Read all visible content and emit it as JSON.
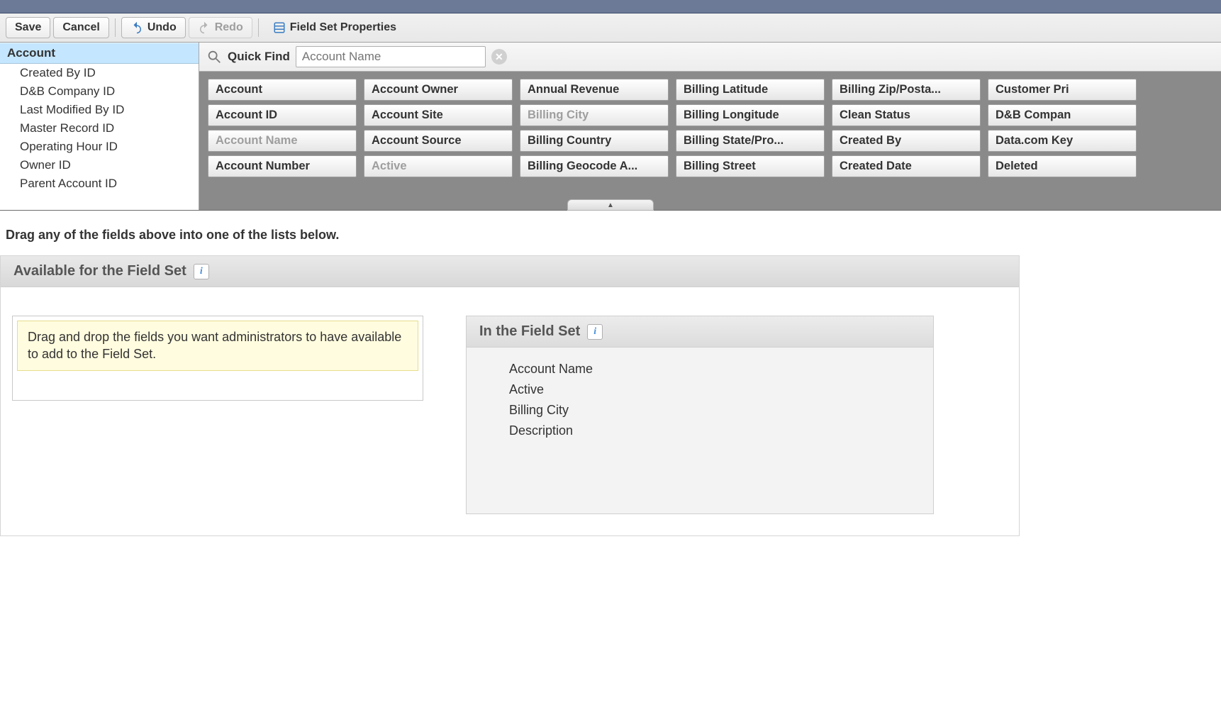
{
  "toolbar": {
    "save": "Save",
    "cancel": "Cancel",
    "undo": "Undo",
    "redo": "Redo",
    "props": "Field Set Properties"
  },
  "object_tree": {
    "title": "Account",
    "items": [
      "Created By ID",
      "D&B Company ID",
      "Last Modified By ID",
      "Master Record ID",
      "Operating Hour ID",
      "Owner ID",
      "Parent Account ID"
    ]
  },
  "quick_find": {
    "label": "Quick Find",
    "placeholder": "Account Name"
  },
  "field_grid": [
    [
      {
        "label": "Account",
        "disabled": false
      },
      {
        "label": "Account ID",
        "disabled": false
      },
      {
        "label": "Account Name",
        "disabled": true
      },
      {
        "label": "Account Number",
        "disabled": false
      }
    ],
    [
      {
        "label": "Account Owner",
        "disabled": false
      },
      {
        "label": "Account Site",
        "disabled": false
      },
      {
        "label": "Account Source",
        "disabled": false
      },
      {
        "label": "Active",
        "disabled": true
      }
    ],
    [
      {
        "label": "Annual Revenue",
        "disabled": false
      },
      {
        "label": "Billing City",
        "disabled": true
      },
      {
        "label": "Billing Country",
        "disabled": false
      },
      {
        "label": "Billing Geocode A...",
        "disabled": false
      }
    ],
    [
      {
        "label": "Billing Latitude",
        "disabled": false
      },
      {
        "label": "Billing Longitude",
        "disabled": false
      },
      {
        "label": "Billing State/Pro...",
        "disabled": false
      },
      {
        "label": "Billing Street",
        "disabled": false
      }
    ],
    [
      {
        "label": "Billing Zip/Posta...",
        "disabled": false
      },
      {
        "label": "Clean Status",
        "disabled": false
      },
      {
        "label": "Created By",
        "disabled": false
      },
      {
        "label": "Created Date",
        "disabled": false
      }
    ],
    [
      {
        "label": "Customer Pri",
        "disabled": false
      },
      {
        "label": "D&B Compan",
        "disabled": false
      },
      {
        "label": "Data.com Key",
        "disabled": false
      },
      {
        "label": "Deleted",
        "disabled": false
      }
    ]
  ],
  "instruction": "Drag any of the fields above into one of the lists below.",
  "available_panel": {
    "title": "Available for the Field Set",
    "hint": "Drag and drop the fields you want administrators to have available to add to the Field Set."
  },
  "in_fieldset": {
    "title": "In the Field Set",
    "items": [
      "Account Name",
      "Active",
      "Billing City",
      "Description"
    ]
  }
}
